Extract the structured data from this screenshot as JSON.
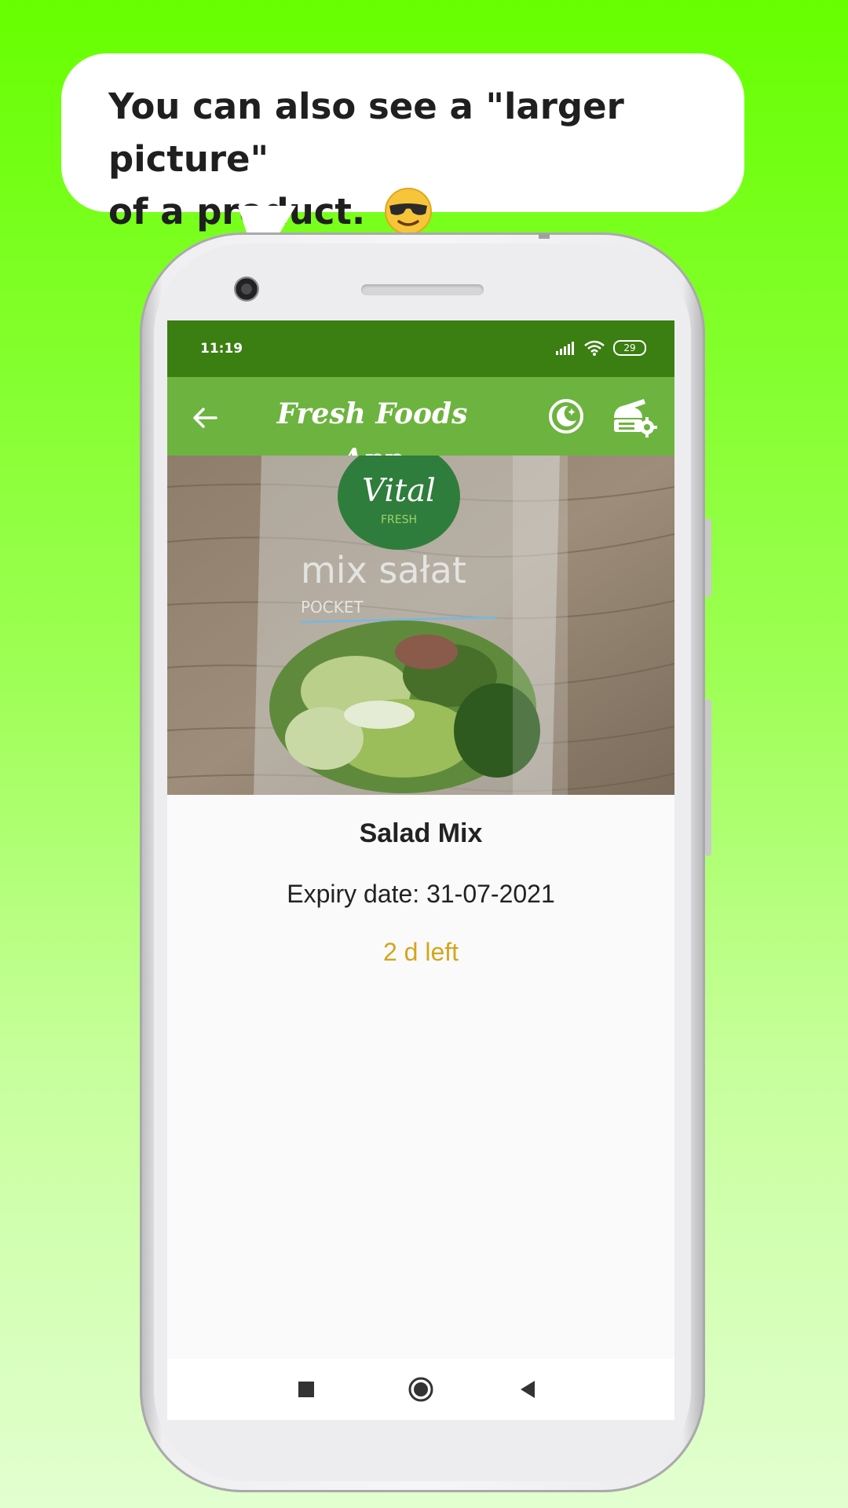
{
  "caption": {
    "line1": "You can also see a \"larger picture\"",
    "line2": "of a product.",
    "emoji_icon": "sunglasses-face-emoji"
  },
  "status_bar": {
    "time": "11:19",
    "battery": "29",
    "icons": [
      "signal-icon",
      "wifi-icon",
      "battery-icon"
    ]
  },
  "app_bar": {
    "title": "Fresh Foods App",
    "icons": [
      "back-arrow-icon",
      "dark-mode-moon-icon",
      "settings-gear-icon"
    ]
  },
  "photo": {
    "brand": "Vital",
    "brand_sub": "FRESH",
    "package_title": "mix sałat",
    "package_sub": "POCKET"
  },
  "product": {
    "name": "Salad Mix",
    "expiry": "Expiry date: 31-07-2021",
    "remaining": "2 d left"
  },
  "nav_bar": {
    "icons": [
      "recents-square-icon",
      "home-circle-icon",
      "back-triangle-icon"
    ]
  },
  "colors": {
    "status_bar": "#3b7e12",
    "app_bar": "#6db33f",
    "remaining_text": "#d4a51c",
    "background_top": "#66ff00"
  }
}
